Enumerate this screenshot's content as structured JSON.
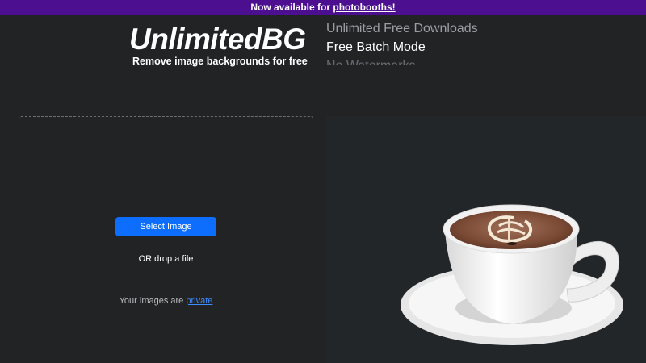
{
  "banner": {
    "prefix": "Now available for ",
    "link": "photobooths!"
  },
  "header": {
    "logo": "UnlimitedBG",
    "tagline": "Remove image backgrounds for free",
    "features": [
      "Unlimited Free Downloads",
      "Free Batch Mode",
      "No Watermarks"
    ]
  },
  "upload": {
    "select_button": "Select Image",
    "drop_text": "OR drop a file",
    "privacy_prefix": "Your images are ",
    "privacy_link": "private"
  },
  "preview": {
    "subject_icon": "coffee-cup-image"
  },
  "colors": {
    "banner": "#4b0f8f",
    "background": "#212325",
    "button": "#0d6efd",
    "link": "#3b8cff"
  }
}
